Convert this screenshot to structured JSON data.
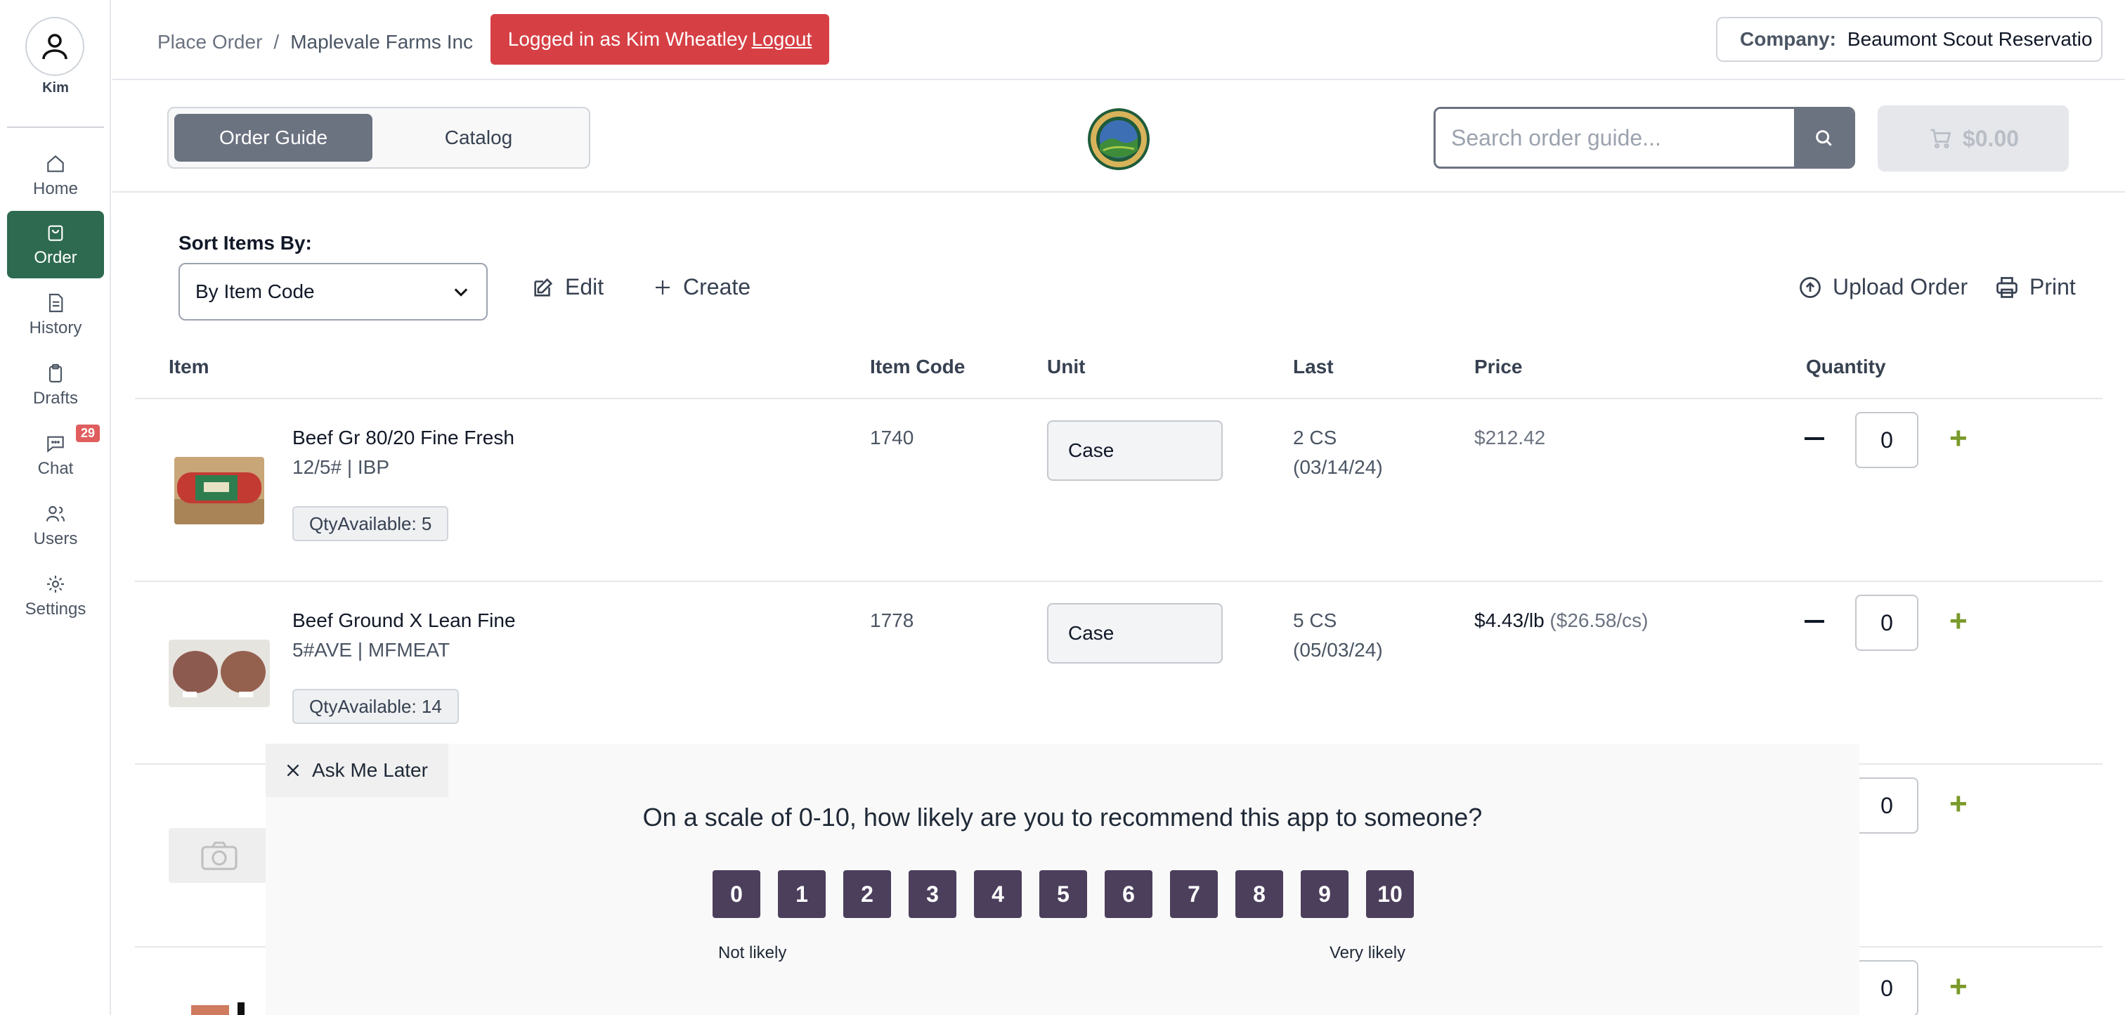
{
  "sidebar": {
    "user_name": "Kim",
    "items": [
      {
        "label": "Home"
      },
      {
        "label": "Order"
      },
      {
        "label": "History"
      },
      {
        "label": "Drafts"
      },
      {
        "label": "Chat",
        "badge": "29"
      },
      {
        "label": "Users"
      },
      {
        "label": "Settings"
      }
    ]
  },
  "header": {
    "breadcrumb": [
      "Place Order",
      "Maplevale Farms Inc"
    ],
    "breadcrumb_sep": "/",
    "login_text": "Logged in as Kim Wheatley",
    "logout_label": "Logout",
    "company_label": "Company:",
    "company_value": "Beaumont Scout Reservatio"
  },
  "subheader": {
    "tabs": [
      "Order Guide",
      "Catalog"
    ],
    "search_placeholder": "Search order guide...",
    "cart_total": "$0.00"
  },
  "toolbar": {
    "sort_label": "Sort Items By:",
    "sort_value": "By Item Code",
    "edit_label": "Edit",
    "create_label": "Create",
    "upload_label": "Upload Order",
    "print_label": "Print"
  },
  "table": {
    "columns": [
      "Item",
      "Item Code",
      "Unit",
      "Last",
      "Price",
      "Quantity"
    ],
    "rows": [
      {
        "name": "Beef Gr 80/20 Fine Fresh",
        "pack": "12/5# | IBP",
        "qty_available": "QtyAvailable: 5",
        "code": "1740",
        "unit": "Case",
        "last_qty": "2 CS",
        "last_date": "(03/14/24)",
        "price": "$212.42",
        "price_extra": "",
        "quantity": "0"
      },
      {
        "name": "Beef Ground X Lean Fine",
        "pack": "5#AVE | MFMEAT",
        "qty_available": "QtyAvailable: 14",
        "code": "1778",
        "unit": "Case",
        "last_qty": "5 CS",
        "last_date": "(05/03/24)",
        "price": "$4.43/lb",
        "price_extra": "($26.58/cs)",
        "quantity": "0"
      },
      {
        "quantity": "0"
      },
      {
        "quantity": "0"
      }
    ]
  },
  "survey": {
    "dismiss_label": "Ask Me Later",
    "question": "On a scale of 0-10, how likely are you to recommend this app to someone?",
    "scores": [
      "0",
      "1",
      "2",
      "3",
      "4",
      "5",
      "6",
      "7",
      "8",
      "9",
      "10"
    ],
    "low_label": "Not likely",
    "high_label": "Very likely"
  },
  "colors": {
    "active_nav": "#2d6a4f",
    "banner": "#d64045",
    "score_button": "#4b3f5c",
    "plus": "#7a9a2a"
  }
}
